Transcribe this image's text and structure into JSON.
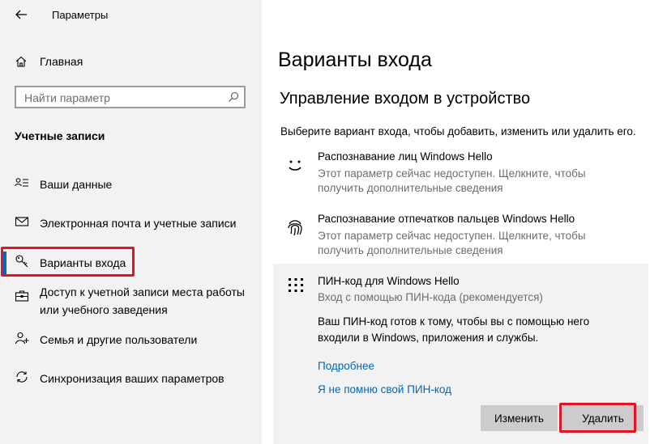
{
  "window": {
    "title": "Параметры"
  },
  "sidebar": {
    "home_label": "Главная",
    "search_placeholder": "Найти параметр",
    "section_title": "Учетные записи",
    "items": [
      {
        "label": "Ваши данные",
        "icon": "person-list-icon"
      },
      {
        "label": "Электронная почта и учетные записи",
        "icon": "mail-icon"
      },
      {
        "label": "Варианты входа",
        "icon": "key-icon",
        "active": true
      },
      {
        "label": "Доступ к учетной записи места работы или учебного заведения",
        "icon": "briefcase-icon"
      },
      {
        "label": "Семья и другие пользователи",
        "icon": "person-add-icon"
      },
      {
        "label": "Синхронизация ваших параметров",
        "icon": "sync-icon"
      }
    ]
  },
  "main": {
    "title": "Варианты входа",
    "subtitle": "Управление входом в устройство",
    "intro": "Выберите вариант входа, чтобы добавить, изменить или удалить его.",
    "options": [
      {
        "name": "Распознавание лиц Windows Hello",
        "description": "Этот параметр сейчас недоступен. Щелкните, чтобы получить дополнительные сведения",
        "icon": "face-icon"
      },
      {
        "name": "Распознавание отпечатков пальцев Windows Hello",
        "description": "Этот параметр сейчас недоступен. Щелкните, чтобы получить дополнительные сведения",
        "icon": "fingerprint-icon"
      }
    ],
    "pin": {
      "name": "ПИН-код для Windows Hello",
      "subtitle": "Вход с помощью ПИН-кода (рекомендуется)",
      "text": "Ваш ПИН-код готов к тому, чтобы вы с помощью него входили в Windows, приложения и службы.",
      "link_more": "Подробнее",
      "link_forgot": "Я не помню свой ПИН-код",
      "change_button": "Изменить",
      "delete_button": "Удалить",
      "icon": "keypad-icon"
    }
  },
  "colors": {
    "sidebar_bg": "#f2f2f2",
    "accent": "#0067c0",
    "highlight": "#e81123",
    "button_bg": "#cccccc"
  }
}
